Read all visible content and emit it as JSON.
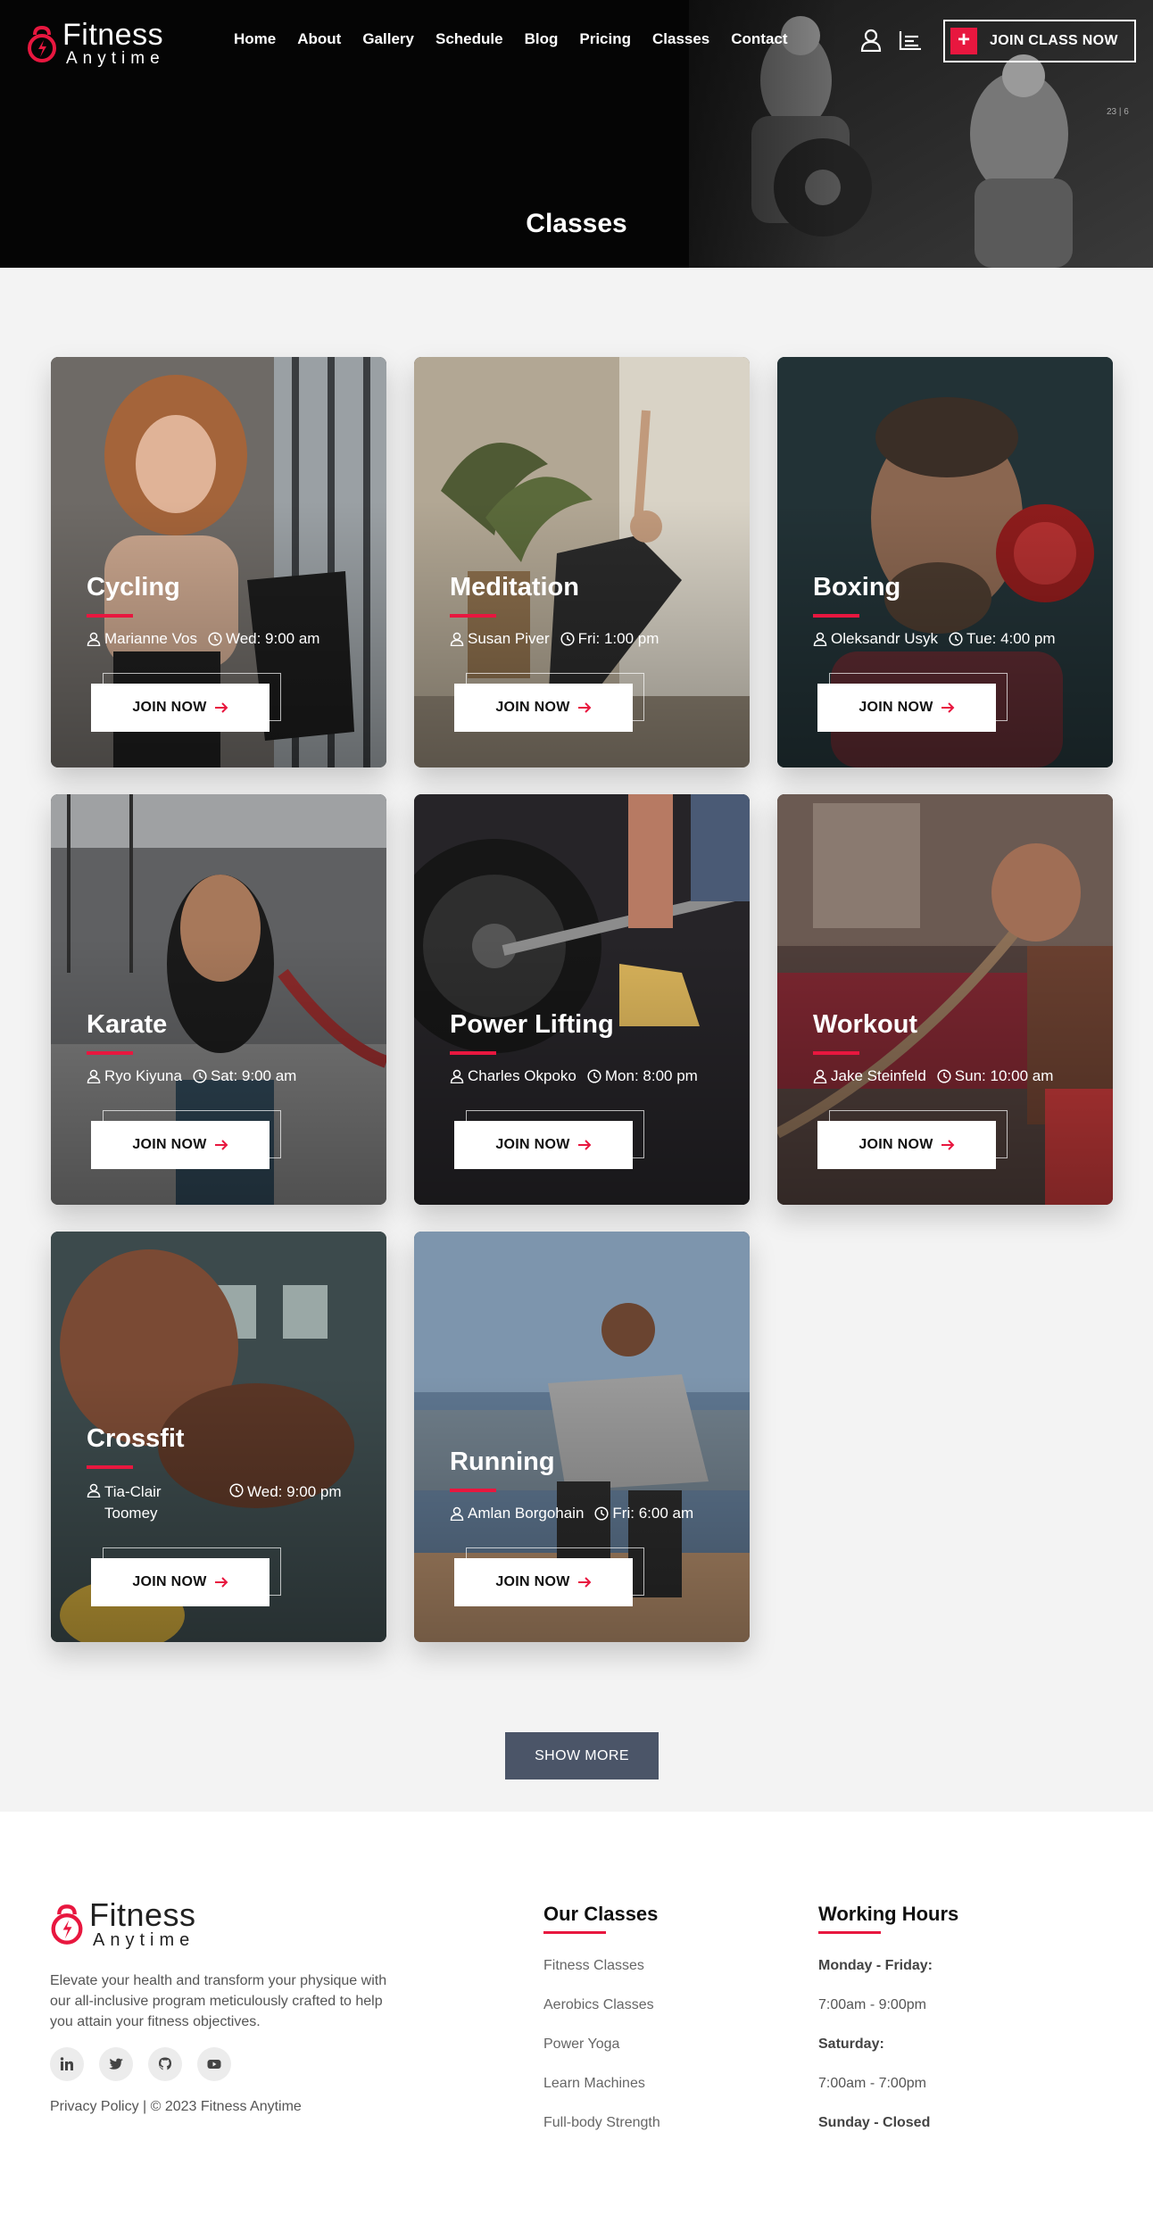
{
  "brand": {
    "name": "Fitness",
    "tagline": "Anytime"
  },
  "nav": {
    "links": [
      "Home",
      "About",
      "Gallery",
      "Schedule",
      "Blog",
      "Pricing",
      "Classes",
      "Contact"
    ],
    "cta_label": "JOIN CLASS NOW",
    "cta_icon": "plus-icon"
  },
  "hero": {
    "title": "Classes",
    "slide_counter": "23 | 6"
  },
  "cards": [
    {
      "title": "Cycling",
      "trainer": "Marianne Vos",
      "time": "Wed: 9:00 am",
      "button": "JOIN NOW"
    },
    {
      "title": "Meditation",
      "trainer": "Susan Piver",
      "time": "Fri: 1:00 pm",
      "button": "JOIN NOW"
    },
    {
      "title": "Boxing",
      "trainer": "Oleksandr Usyk",
      "time": "Tue: 4:00 pm",
      "button": "JOIN NOW"
    },
    {
      "title": "Karate",
      "trainer": "Ryo Kiyuna",
      "time": "Sat: 9:00 am",
      "button": "JOIN NOW"
    },
    {
      "title": "Power Lifting",
      "trainer": "Charles Okpoko",
      "time": "Mon: 8:00 pm",
      "button": "JOIN NOW"
    },
    {
      "title": "Workout",
      "trainer": "Jake Steinfeld",
      "time": "Sun: 10:00 am",
      "button": "JOIN NOW"
    },
    {
      "title": "Crossfit",
      "trainer": "Tia-Clair Toomey",
      "time": "Wed: 9:00 pm",
      "button": "JOIN NOW"
    },
    {
      "title": "Running",
      "trainer": "Amlan Borgohain",
      "time": "Fri: 6:00 am",
      "button": "JOIN NOW"
    }
  ],
  "show_more": "SHOW MORE",
  "footer": {
    "description": "Elevate your health and transform your physique with our all-inclusive program meticulously crafted to help you attain your fitness objectives.",
    "social": [
      "linkedin-icon",
      "twitter-icon",
      "github-icon",
      "youtube-icon"
    ],
    "privacy": "Privacy Policy",
    "copyright": " | © 2023 Fitness Anytime",
    "classes_heading": "Our Classes",
    "classes": [
      "Fitness Classes",
      "Aerobics Classes",
      "Power Yoga",
      "Learn Machines",
      "Full-body Strength"
    ],
    "hours_heading": "Working Hours",
    "hours": [
      "Monday - Friday:",
      "7:00am - 9:00pm",
      "Saturday:",
      "7:00am - 7:00pm",
      "Sunday - Closed"
    ]
  },
  "colors": {
    "accent": "#e8173f",
    "button": "#4b5568",
    "hero_bg": "#050505",
    "section_bg": "#f3f3f3"
  }
}
